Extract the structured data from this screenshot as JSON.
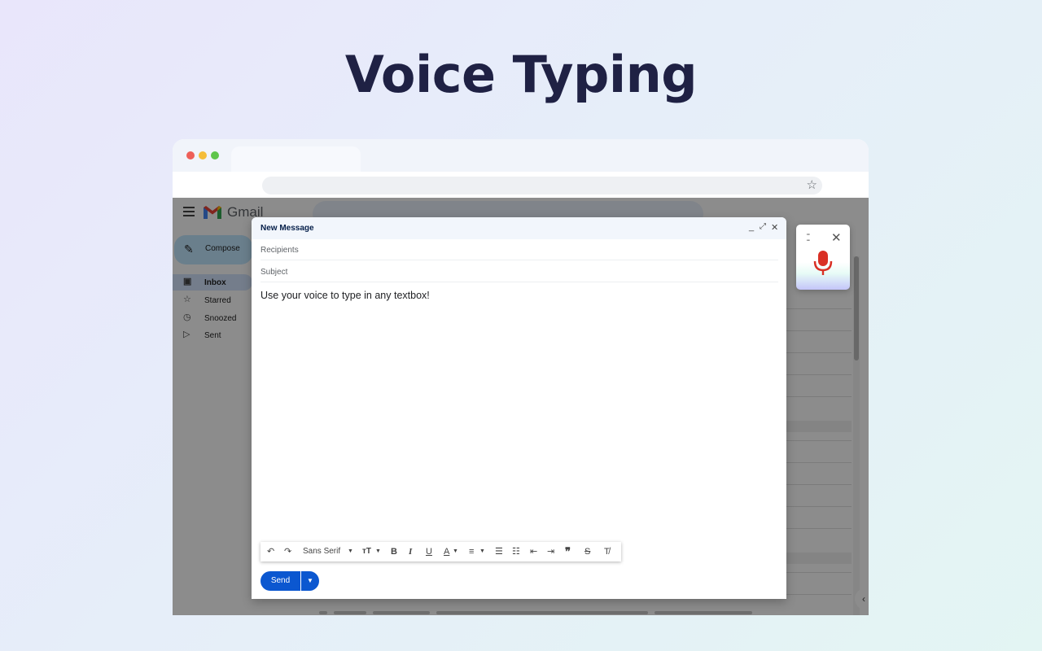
{
  "hero": {
    "title": "Voice Typing"
  },
  "gmail": {
    "brand": "Gmail",
    "compose_label": "Compose",
    "nav": [
      {
        "label": "Inbox",
        "icon": "inbox-icon"
      },
      {
        "label": "Starred",
        "icon": "star-icon"
      },
      {
        "label": "Snoozed",
        "icon": "clock-icon"
      },
      {
        "label": "Sent",
        "icon": "send-icon"
      }
    ]
  },
  "compose": {
    "title": "New Message",
    "recipients_placeholder": "Recipients",
    "subject_placeholder": "Subject",
    "body": "Use your voice to type in any textbox!",
    "font_name": "Sans Serif",
    "send_label": "Send"
  },
  "colors": {
    "title": "#1f2144",
    "send": "#0b57d0",
    "mic": "#d93025",
    "compose_pill": "#c2e7ff"
  }
}
